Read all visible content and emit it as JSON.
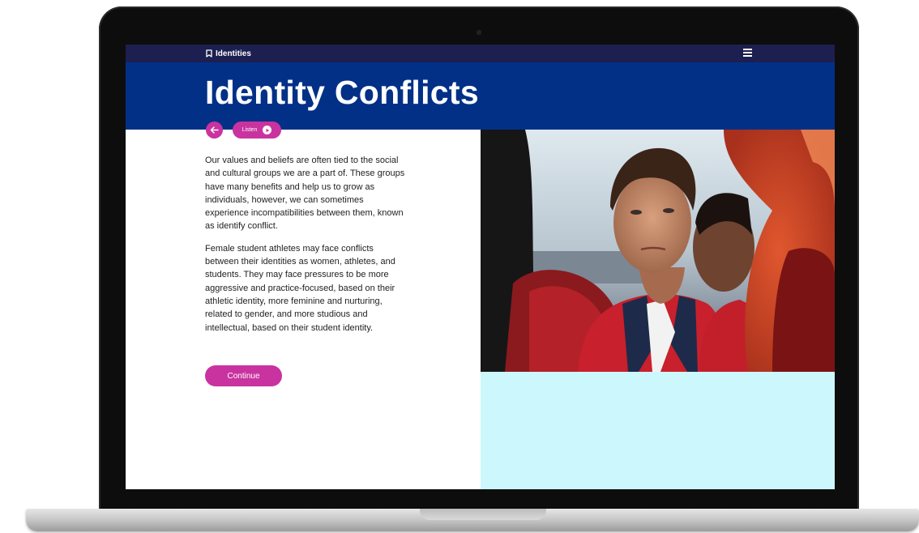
{
  "topbar": {
    "section_label": "Identities",
    "bookmark_icon": "bookmark-icon",
    "menu_icon": "hamburger-menu-icon"
  },
  "header": {
    "title": "Identity Conflicts"
  },
  "controls": {
    "back_icon": "arrow-left-icon",
    "listen_label": "Listen",
    "play_icon": "play-icon"
  },
  "content": {
    "paragraphs": [
      "Our values and beliefs are often tied to the social and cultural groups we are a part of. These groups have many benefits and help us to grow as individuals, however, we can sometimes experience incompatibilities between them, known as identify conflict.",
      "Female student athletes may face conflicts between their identities as women, athletes, and students. They may face pressures to be more aggressive and practice-focused, based on their athletic identity, more feminine and nurturing, related to gender, and more studious and intellectual, based on their student identity."
    ],
    "continue_label": "Continue"
  },
  "colors": {
    "topbar": "#1c1f4f",
    "header": "#023087",
    "accent": "#c9339f",
    "panel": "#ccf7fd"
  }
}
